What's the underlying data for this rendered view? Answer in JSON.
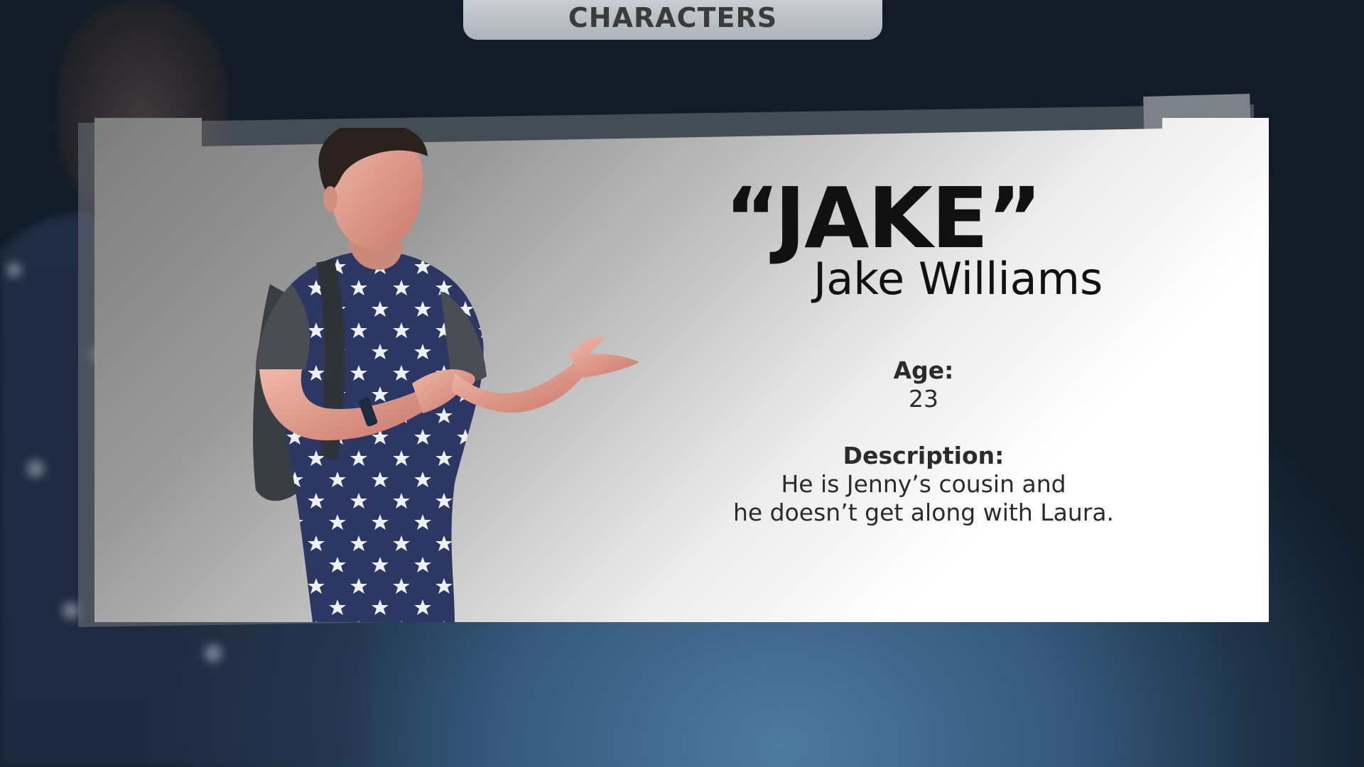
{
  "header": {
    "tab_label": "CHARACTERS"
  },
  "character": {
    "nickname": "“JAKE”",
    "full_name": "Jake Williams",
    "age_label": "Age:",
    "age_value": "23",
    "description_label": "Description",
    "description_colon": ":",
    "description_line1": "He is Jenny’s cousin and",
    "description_line2": "he doesn’t get along with Laura."
  },
  "colors": {
    "background": "#36597c",
    "card_light": "#ffffff",
    "card_dark": "#7d7d7d",
    "tab": "#b7bbc0",
    "text": "#111111"
  }
}
